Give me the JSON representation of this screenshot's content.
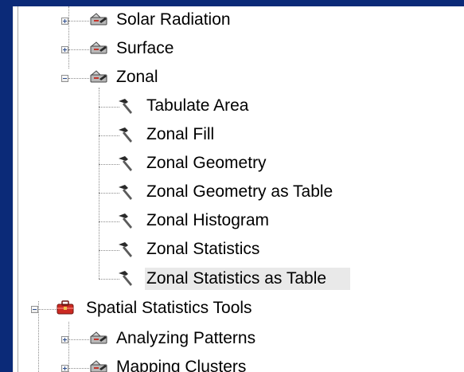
{
  "tree": {
    "items": [
      {
        "label": "Solar Radiation",
        "type": "toolset",
        "state": "collapsed"
      },
      {
        "label": "Surface",
        "type": "toolset",
        "state": "collapsed"
      },
      {
        "label": "Zonal",
        "type": "toolset",
        "state": "expanded"
      },
      {
        "label": "Tabulate Area",
        "type": "tool"
      },
      {
        "label": "Zonal Fill",
        "type": "tool"
      },
      {
        "label": "Zonal Geometry",
        "type": "tool"
      },
      {
        "label": "Zonal Geometry as Table",
        "type": "tool"
      },
      {
        "label": "Zonal Histogram",
        "type": "tool"
      },
      {
        "label": "Zonal Statistics",
        "type": "tool"
      },
      {
        "label": "Zonal Statistics as Table",
        "type": "tool",
        "selected": true
      },
      {
        "label": "Spatial Statistics Tools",
        "type": "toolbox",
        "state": "expanded"
      },
      {
        "label": "Analyzing Patterns",
        "type": "toolset",
        "state": "collapsed"
      },
      {
        "label": "Mapping Clusters",
        "type": "toolset",
        "state": "collapsed"
      }
    ]
  },
  "colors": {
    "background": "#0b2a78",
    "panel": "#ffffff",
    "selection": "#e9e9e9",
    "toolset_icon": "#c0c0c0",
    "toolbox_icon": "#cc2a22",
    "hammer_head": "#2a2a2a",
    "hammer_handle": "#5b5b5b"
  }
}
